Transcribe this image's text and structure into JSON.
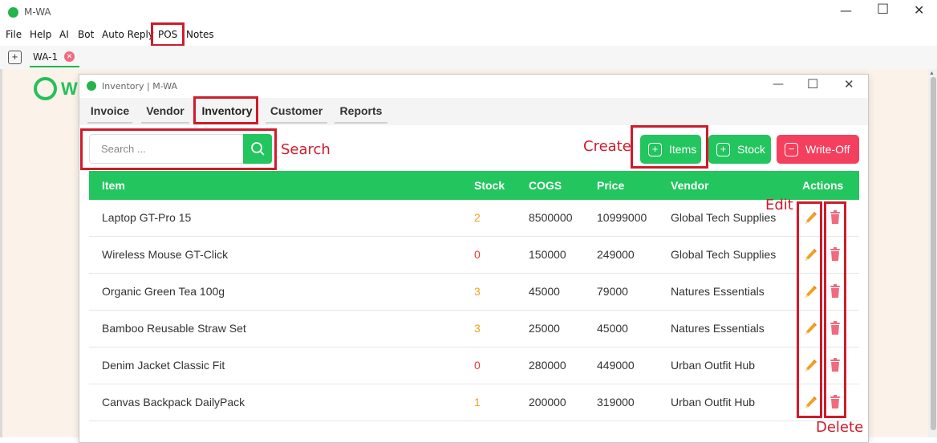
{
  "app": {
    "title": "M-WA"
  },
  "menu": [
    "File",
    "Help",
    "AI",
    "Bot",
    "Auto Reply",
    "POS",
    "Notes"
  ],
  "tab": {
    "label": "WA-1"
  },
  "background_logo_text": "W",
  "inventory_window": {
    "title": "Inventory | M-WA",
    "nav_tabs": [
      "Invoice",
      "Vendor",
      "Inventory",
      "Customer",
      "Reports"
    ],
    "active_tab": "Inventory",
    "search_placeholder": "Search ...",
    "buttons": {
      "items": "Items",
      "stock": "Stock",
      "write_off": "Write-Off"
    },
    "columns": [
      "Item",
      "Stock",
      "COGS",
      "Price",
      "Vendor",
      "Actions"
    ],
    "rows": [
      {
        "item": "Laptop GT-Pro 15",
        "stock": "2",
        "cogs": "8500000",
        "price": "10999000",
        "vendor": "Global Tech Supplies",
        "stock_color": "#f0a020"
      },
      {
        "item": "Wireless Mouse GT-Click",
        "stock": "0",
        "cogs": "150000",
        "price": "249000",
        "vendor": "Global Tech Supplies",
        "stock_color": "#e53935"
      },
      {
        "item": "Organic Green Tea 100g",
        "stock": "3",
        "cogs": "45000",
        "price": "79000",
        "vendor": "Natures Essentials",
        "stock_color": "#f0a020"
      },
      {
        "item": "Bamboo Reusable Straw Set",
        "stock": "3",
        "cogs": "25000",
        "price": "45000",
        "vendor": "Natures Essentials",
        "stock_color": "#f0a020"
      },
      {
        "item": "Denim Jacket Classic Fit",
        "stock": "0",
        "cogs": "280000",
        "price": "449000",
        "vendor": "Urban Outfit Hub",
        "stock_color": "#e53935"
      },
      {
        "item": "Canvas Backpack DailyPack",
        "stock": "1",
        "cogs": "200000",
        "price": "319000",
        "vendor": "Urban Outfit Hub",
        "stock_color": "#f0a020"
      }
    ]
  },
  "annotations": {
    "search": "Search",
    "create": "Create",
    "edit": "Edit",
    "delete": "Delete"
  },
  "colors": {
    "accent_green": "#22c55e",
    "danger": "#f43f5e",
    "annotation_red": "#d11a2a"
  },
  "icons": [
    "whatsapp-icon",
    "search-icon",
    "plus-icon",
    "minus-icon",
    "pencil-icon",
    "trash-icon"
  ]
}
